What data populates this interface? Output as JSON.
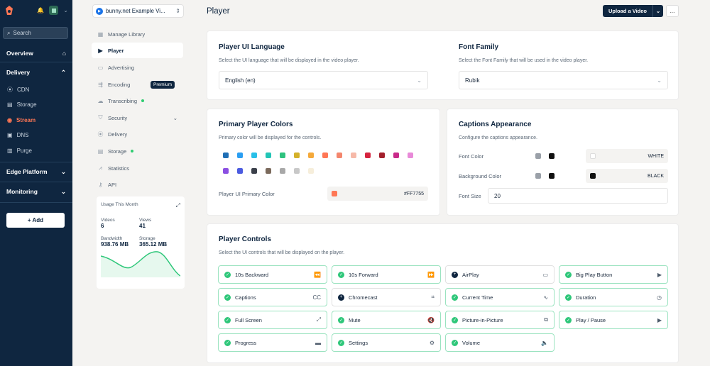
{
  "sidebar": {
    "search_placeholder": "Search",
    "sections": {
      "overview": "Overview",
      "delivery": "Delivery",
      "edge": "Edge Platform",
      "monitoring": "Monitoring"
    },
    "delivery_items": [
      "CDN",
      "Storage",
      "Stream",
      "DNS",
      "Purge"
    ],
    "add_label": "+ Add"
  },
  "library": {
    "selected": "bunny.net Example Vi...",
    "menu": [
      "Manage Library",
      "Player",
      "Advertising",
      "Encoding",
      "Transcribing",
      "Security",
      "Delivery",
      "Storage",
      "Statistics",
      "API"
    ],
    "premium_badge": "Premium",
    "usage": {
      "title": "Usage This Month",
      "videos_label": "Videos",
      "videos": "6",
      "views_label": "Views",
      "views": "41",
      "bandwidth_label": "Bandwidth",
      "bandwidth": "938.76 MB",
      "storage_label": "Storage",
      "storage": "365.12 MB"
    }
  },
  "header": {
    "title": "Player",
    "upload": "Upload a Video",
    "more": "..."
  },
  "language": {
    "title": "Player UI Language",
    "desc": "Select the UI language that will be displayed in the video player.",
    "value": "English (en)"
  },
  "font": {
    "title": "Font Family",
    "desc": "Select the Font Family that will be used in the video player.",
    "value": "Rubik"
  },
  "colors": {
    "title": "Primary Player Colors",
    "desc": "Primary color will be displayed for the controls.",
    "palette": [
      "#1f6fb5",
      "#2a9ef2",
      "#29bfe8",
      "#22c5b6",
      "#2ec27e",
      "#d4b12a",
      "#f5a93a",
      "#ff7755",
      "#f4866d",
      "#f6b9a8",
      "#d6243f",
      "#a31f2c",
      "#c92a8a",
      "#e88ad8",
      "#8b4fe2",
      "#4b5be0",
      "#3a3f4a",
      "#7b6a5c",
      "#a8a8a8",
      "#c8c8c8",
      "#f6eedb"
    ],
    "primary_label": "Player UI Primary Color",
    "primary_value": "#FF7755",
    "primary_hex": "#ff7755"
  },
  "captions": {
    "title": "Captions Appearance",
    "desc": "Configure the captions appearance.",
    "font_color_label": "Font Color",
    "font_color_value": "WHITE",
    "bg_color_label": "Background Color",
    "bg_color_value": "BLACK",
    "size_label": "Font Size",
    "size_value": "20"
  },
  "controls": {
    "title": "Player Controls",
    "desc": "Select the UI controls that will be displayed on the player.",
    "items": [
      {
        "label": "10s Backward",
        "on": true,
        "icon": "⏪"
      },
      {
        "label": "10s Forward",
        "on": true,
        "icon": "⏩"
      },
      {
        "label": "AirPlay",
        "on": false,
        "icon": "▭"
      },
      {
        "label": "Big Play Button",
        "on": true,
        "icon": "▶"
      },
      {
        "label": "Captions",
        "on": true,
        "icon": "CC"
      },
      {
        "label": "Chromecast",
        "on": false,
        "icon": "⌗"
      },
      {
        "label": "Current Time",
        "on": true,
        "icon": "∿"
      },
      {
        "label": "Duration",
        "on": true,
        "icon": "◷"
      },
      {
        "label": "Full Screen",
        "on": true,
        "icon": "⤢"
      },
      {
        "label": "Mute",
        "on": true,
        "icon": "🔇"
      },
      {
        "label": "Picture-in-Picture",
        "on": true,
        "icon": "⧉"
      },
      {
        "label": "Play / Pause",
        "on": true,
        "icon": "▶"
      },
      {
        "label": "Progress",
        "on": true,
        "icon": "▬"
      },
      {
        "label": "Settings",
        "on": true,
        "icon": "⚙"
      },
      {
        "label": "Volume",
        "on": true,
        "icon": "🔈"
      }
    ]
  }
}
